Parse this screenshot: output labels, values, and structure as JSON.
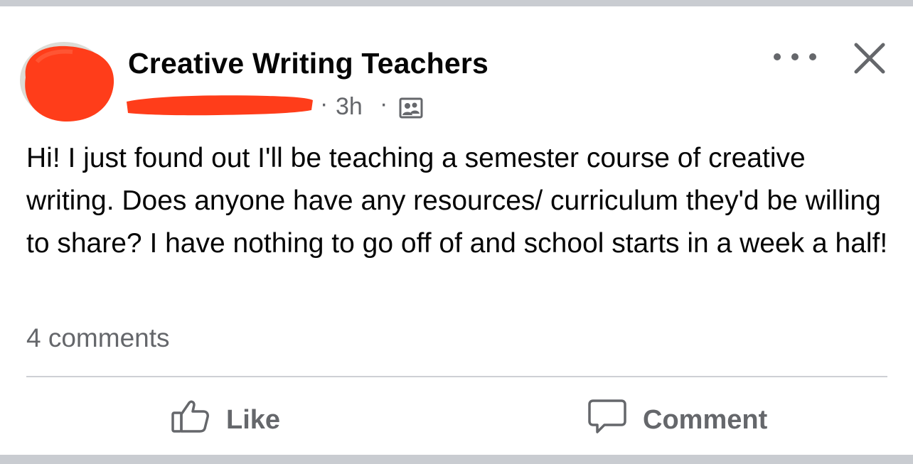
{
  "group": {
    "name": "Creative Writing Teachers"
  },
  "post": {
    "separator": "·",
    "timestamp": "3h",
    "text": "Hi! I just found out I'll be teaching a semester course of creative writing. Does anyone have any resources/ curriculum they'd be willing to share? I have nothing to go off of and school starts in a week a half!",
    "comments_count": "4 comments"
  },
  "actions": {
    "like_label": "Like",
    "comment_label": "Comment"
  },
  "icons": {
    "privacy": "group-members-icon",
    "more": "more-options-icon",
    "close": "close-icon",
    "like": "thumbs-up-icon",
    "comment": "comment-bubble-icon"
  },
  "colors": {
    "redaction": "#ff3d1a",
    "text_primary": "#050505",
    "text_secondary": "#65676b",
    "divider": "#ced0d4",
    "band": "#c9ccd1"
  }
}
